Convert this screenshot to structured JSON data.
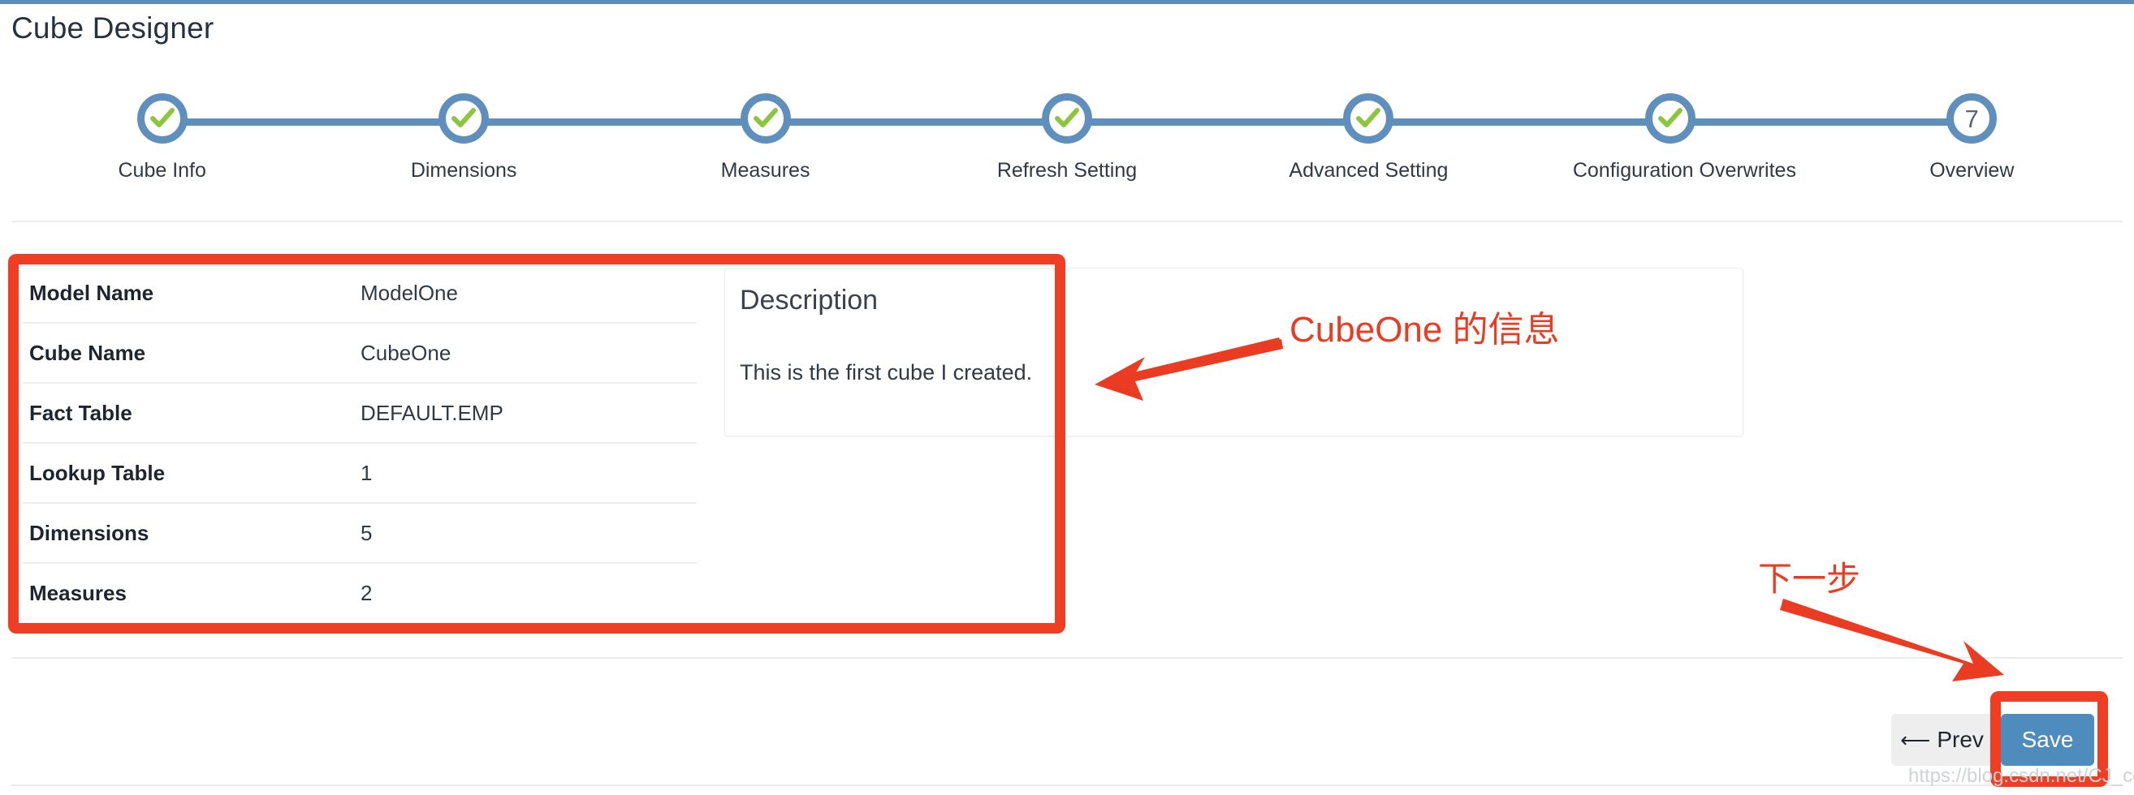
{
  "header": {
    "title": "Cube Designer",
    "accent_color": "#5b8db8"
  },
  "stepper": {
    "current_step": 7,
    "circle_color": "#5f90bd",
    "check_color": "#8cc63f",
    "steps": [
      {
        "index": 1,
        "label": "Cube Info",
        "state": "done",
        "marker": "check"
      },
      {
        "index": 2,
        "label": "Dimensions",
        "state": "done",
        "marker": "check"
      },
      {
        "index": 3,
        "label": "Measures",
        "state": "done",
        "marker": "check"
      },
      {
        "index": 4,
        "label": "Refresh Setting",
        "state": "done",
        "marker": "check"
      },
      {
        "index": 5,
        "label": "Advanced Setting",
        "state": "done",
        "marker": "check"
      },
      {
        "index": 6,
        "label": "Configuration Overwrites",
        "state": "done",
        "marker": "check"
      },
      {
        "index": 7,
        "label": "Overview",
        "state": "current",
        "marker": "7"
      }
    ]
  },
  "summary": {
    "rows": [
      {
        "key": "Model Name",
        "value": "ModelOne"
      },
      {
        "key": "Cube Name",
        "value": "CubeOne"
      },
      {
        "key": "Fact Table",
        "value": "DEFAULT.EMP"
      },
      {
        "key": "Lookup Table",
        "value": "1"
      },
      {
        "key": "Dimensions",
        "value": "5"
      },
      {
        "key": "Measures",
        "value": "2"
      }
    ]
  },
  "description": {
    "title": "Description",
    "text": "This is the first cube I created."
  },
  "footer": {
    "prev_label": "Prev",
    "prev_icon": "arrow-left-icon",
    "save_label": "Save",
    "save_color": "#4f8cbe"
  },
  "annotations": {
    "color": "#ea3c22",
    "info_note": "CubeOne 的信息",
    "next_note": "下一步"
  },
  "watermark": "https://blog.csdn.net/CJ_codingfish"
}
